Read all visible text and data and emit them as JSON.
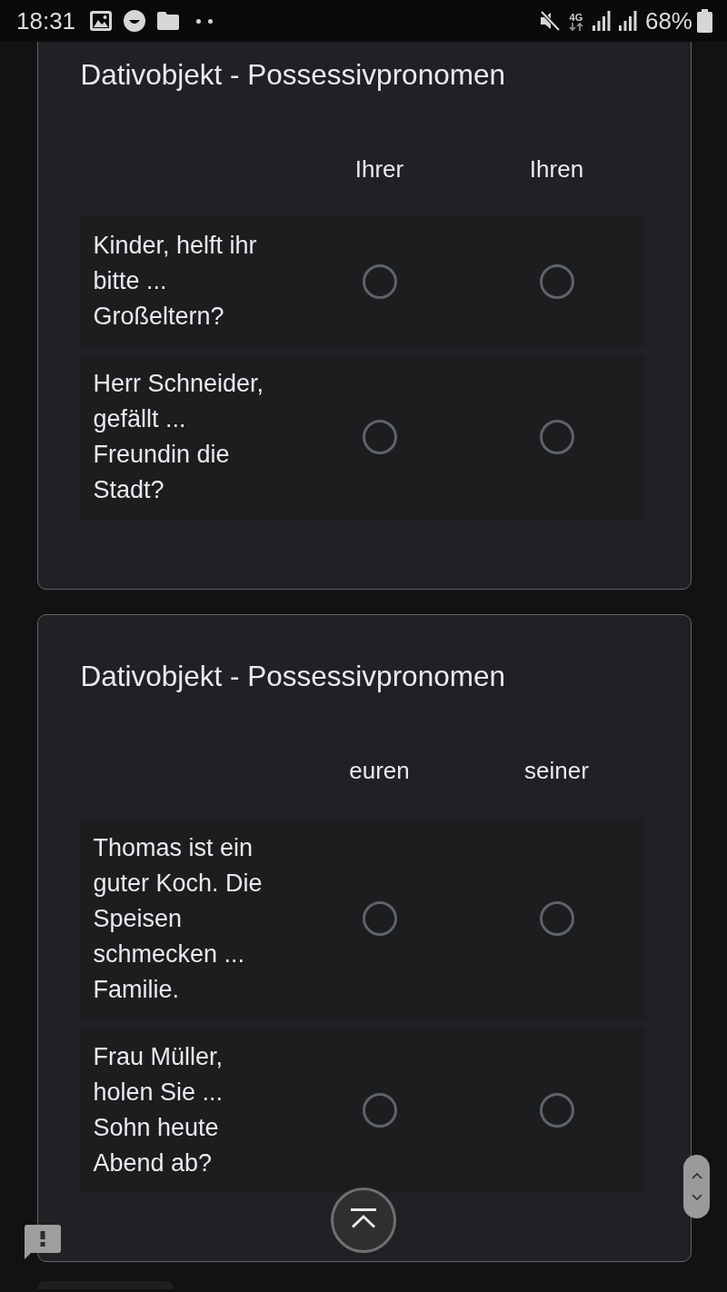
{
  "status_bar": {
    "time": "18:31",
    "network": "4G",
    "battery": "68%"
  },
  "sections": [
    {
      "title": "Dativobjekt - Possessivpronomen",
      "columns": [
        "Ihrer",
        "Ihren"
      ],
      "rows": [
        {
          "question": "Kinder, helft ihr bitte ... Großeltern?",
          "radios": [
            {
              "selected": false
            },
            {
              "selected": false
            }
          ]
        },
        {
          "question": "Herr Schneider, gefällt ... Freundin die Stadt?",
          "radios": [
            {
              "selected": false
            },
            {
              "selected": false
            }
          ]
        }
      ]
    },
    {
      "title": "Dativobjekt - Possessivpronomen",
      "columns": [
        "euren",
        "seiner"
      ],
      "rows": [
        {
          "question": "Thomas ist ein guter Koch. Die Speisen schmecken ... Familie.",
          "radios": [
            {
              "selected": false
            },
            {
              "selected": false
            }
          ]
        },
        {
          "question": "Frau Müller, holen Sie ... Sohn heute Abend ab?",
          "radios": [
            {
              "selected": false
            },
            {
              "selected": false
            }
          ]
        }
      ]
    }
  ]
}
